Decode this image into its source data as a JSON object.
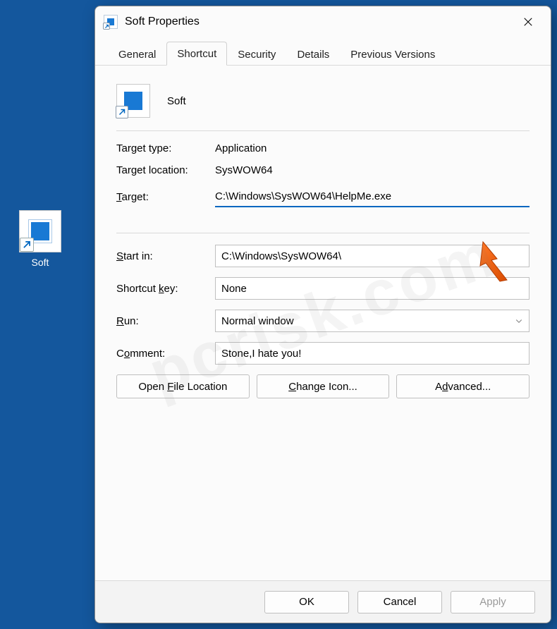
{
  "desktop": {
    "icon_label": "Soft"
  },
  "dialog": {
    "title": "Soft Properties",
    "tabs": {
      "general": "General",
      "shortcut": "Shortcut",
      "security": "Security",
      "details": "Details",
      "previous": "Previous Versions"
    },
    "name_value": "Soft",
    "fields": {
      "target_type_label": "Target type:",
      "target_type_value": "Application",
      "target_location_label": "Target location:",
      "target_location_value": "SysWOW64",
      "target_label_pre": "T",
      "target_label_post": "arget:",
      "target_value": "C:\\Windows\\SysWOW64\\HelpMe.exe",
      "start_in_label_pre": "S",
      "start_in_label_post": "tart in:",
      "start_in_value": "C:\\Windows\\SysWOW64\\",
      "shortcut_key_label_pre": "Shortcut ",
      "shortcut_key_label_u": "k",
      "shortcut_key_label_post": "ey:",
      "shortcut_key_value": "None",
      "run_label_pre": "R",
      "run_label_post": "un:",
      "run_value": "Normal window",
      "comment_label_pre": "C",
      "comment_label_u": "o",
      "comment_label_post": "mment:",
      "comment_value": "Stone,I hate you!"
    },
    "mid_buttons": {
      "open_location_pre": "Open ",
      "open_location_u": "F",
      "open_location_post": "ile Location",
      "change_icon_pre": "",
      "change_icon_u": "C",
      "change_icon_post": "hange Icon...",
      "advanced_pre": "A",
      "advanced_u": "d",
      "advanced_post": "vanced..."
    },
    "footer": {
      "ok": "OK",
      "cancel": "Cancel",
      "apply": "Apply"
    }
  },
  "watermark": "pcrisk.com"
}
